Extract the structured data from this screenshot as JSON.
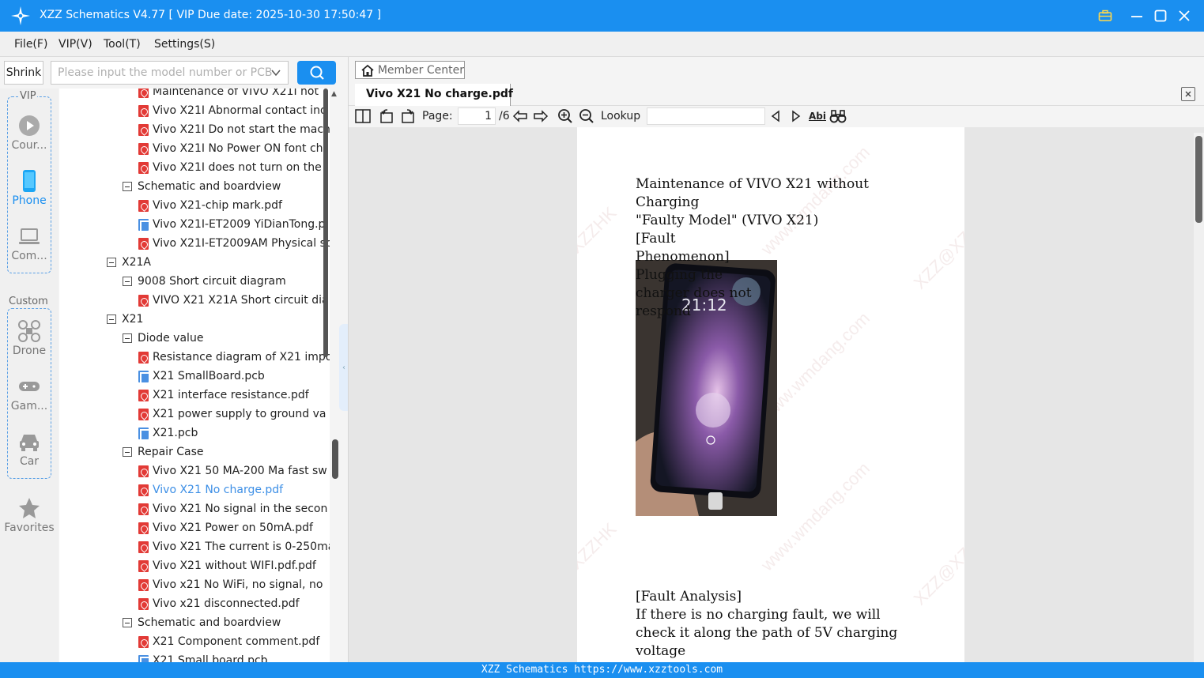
{
  "window": {
    "title": "XZZ Schematics V4.77 [ VIP Due date: 2025-10-30 17:50:47 ]"
  },
  "menu": [
    "File(F)",
    "VIP(V)",
    "Tool(T)",
    "Settings(S)"
  ],
  "search": {
    "shrink_label": "Shrink",
    "placeholder": "Please input the model number or PCB"
  },
  "categories": {
    "vip_label": "VIP",
    "vip_items": [
      {
        "label": "Cour...",
        "icon": "play-icon"
      },
      {
        "label": "Phone",
        "icon": "phone-icon"
      },
      {
        "label": "Com...",
        "icon": "laptop-icon"
      }
    ],
    "custom_label": "Custom",
    "custom_items": [
      {
        "label": "Drone",
        "icon": "drone-icon"
      },
      {
        "label": "Gam...",
        "icon": "gamepad-icon"
      },
      {
        "label": "Car",
        "icon": "car-icon"
      }
    ],
    "favorites_label": "Favorites"
  },
  "tree": [
    {
      "label": "Maintenance of VIVO X21I not",
      "kind": "pdf",
      "level": 2
    },
    {
      "label": "Vivo X21I Abnormal contact ind",
      "kind": "pdf",
      "level": 2
    },
    {
      "label": "Vivo X21I Do not start the mach",
      "kind": "pdf",
      "level": 2
    },
    {
      "label": "Vivo X21I No Power ON font ch",
      "kind": "pdf",
      "level": 2
    },
    {
      "label": "Vivo X21I does not turn on the",
      "kind": "pdf",
      "level": 2
    },
    {
      "label": "Schematic and boardview",
      "kind": "folder",
      "level": 1
    },
    {
      "label": "Vivo X21-chip mark.pdf",
      "kind": "pdf",
      "level": 2
    },
    {
      "label": "Vivo X21I-ET2009 YiDianTong.p",
      "kind": "pcb",
      "level": 2
    },
    {
      "label": "Vivo X21I-ET2009AM Physical sc",
      "kind": "pdf",
      "level": 2
    },
    {
      "label": "X21A",
      "kind": "folder",
      "level": 0
    },
    {
      "label": "9008 Short circuit diagram",
      "kind": "folder",
      "level": 1
    },
    {
      "label": "VIVO X21  X21A Short circuit dia",
      "kind": "pdf",
      "level": 2
    },
    {
      "label": "X21",
      "kind": "folder",
      "level": 0
    },
    {
      "label": "Diode value",
      "kind": "folder",
      "level": 1
    },
    {
      "label": "Resistance diagram of X21 impo",
      "kind": "pdf",
      "level": 2
    },
    {
      "label": "X21 SmallBoard.pcb",
      "kind": "pcb",
      "level": 2
    },
    {
      "label": "X21 interface resistance.pdf",
      "kind": "pdf",
      "level": 2
    },
    {
      "label": "X21 power supply to ground va",
      "kind": "pdf",
      "level": 2
    },
    {
      "label": "X21.pcb",
      "kind": "pcb",
      "level": 2
    },
    {
      "label": "Repair Case",
      "kind": "folder",
      "level": 1
    },
    {
      "label": "Vivo X21 50 MA-200 Ma fast sw",
      "kind": "pdf",
      "level": 2
    },
    {
      "label": "Vivo X21 No charge.pdf",
      "kind": "pdf",
      "level": 2,
      "active": true
    },
    {
      "label": "Vivo X21 No signal in the secon",
      "kind": "pdf",
      "level": 2
    },
    {
      "label": "Vivo X21 Power on 50mA.pdf",
      "kind": "pdf",
      "level": 2
    },
    {
      "label": "Vivo X21 The current is 0-250ma",
      "kind": "pdf",
      "level": 2
    },
    {
      "label": "Vivo X21 without WIFI.pdf.pdf",
      "kind": "pdf",
      "level": 2
    },
    {
      "label": "Vivo x21 No WiFi, no signal, no",
      "kind": "pdf",
      "level": 2
    },
    {
      "label": "Vivo x21 disconnected.pdf",
      "kind": "pdf",
      "level": 2
    },
    {
      "label": "Schematic and boardview",
      "kind": "folder",
      "level": 1
    },
    {
      "label": "X21 Component comment.pdf",
      "kind": "pdf",
      "level": 2
    },
    {
      "label": "X21 Small board.pcb",
      "kind": "pcb",
      "level": 2
    }
  ],
  "right": {
    "member_center": "Member Center",
    "doc_tab": "Vivo X21 No charge.pdf",
    "page_label": "Page:",
    "page_value": "1",
    "page_total": "/6",
    "lookup_label": "Lookup",
    "abi_label": "Abi"
  },
  "pdf": {
    "block1": "Maintenance of VIVO X21 without\nCharging\n\"Faulty Model\" (VIVO X21)\n[Fault\nPhenomenon]\nPlugging the\ncharger does not\nrespond",
    "block2": "[Fault Analysis]\nIf there is no charging fault, we will\ncheck it along the path of 5V charging\nvoltage",
    "photo_time": "21:12",
    "watermark_text": "XZZ@XZZHK",
    "watermark_url": "www.wmdang.com"
  },
  "status": "XZZ Schematics https://www.xzztools.com"
}
